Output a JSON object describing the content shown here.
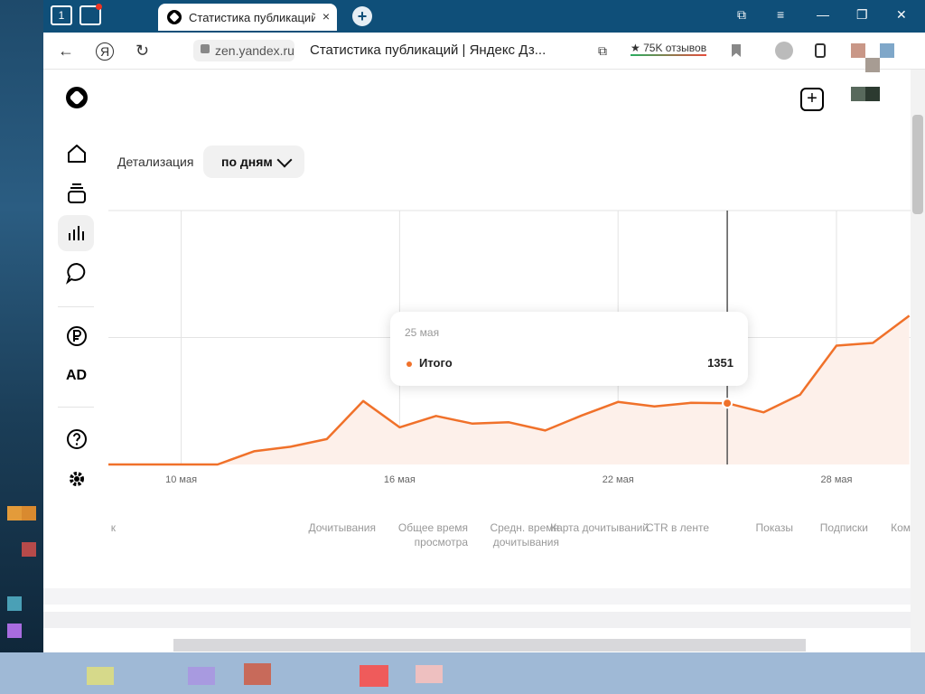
{
  "browser": {
    "tab_number": "1",
    "tab_title": "Статистика публикаций",
    "tab_close": "×",
    "newtab": "+",
    "host": "zen.yandex.ru",
    "page_title": "Статистика публикаций | Яндекс Дз...",
    "reviews": "★ 75K отзывов",
    "win_buttons": [
      "⧉",
      "≡",
      "—",
      "❐",
      "✕"
    ]
  },
  "app": {
    "ad_label": "AD",
    "detail_label": "Детализация",
    "detail_value": "по дням"
  },
  "chart_data": {
    "type": "area",
    "x": [
      "8 мая",
      "9 мая",
      "10 мая",
      "11 мая",
      "12 мая",
      "13 мая",
      "14 мая",
      "15 мая",
      "16 мая",
      "17 мая",
      "18 мая",
      "19 мая",
      "20 мая",
      "21 мая",
      "22 мая",
      "23 мая",
      "24 мая",
      "25 мая",
      "26 мая",
      "27 мая",
      "28 мая",
      "29 мая",
      "30 мая"
    ],
    "series": [
      {
        "name": "Итого",
        "values": [
          0,
          0,
          0,
          0,
          290,
          390,
          560,
          1400,
          820,
          1070,
          900,
          930,
          750,
          1080,
          1380,
          1280,
          1360,
          1351,
          1150,
          1540,
          2620,
          2680,
          3280
        ]
      }
    ],
    "x_tick_labels": [
      "10 мая",
      "16 мая",
      "22 мая",
      "28 мая"
    ],
    "ylim": [
      0,
      5600
    ],
    "grid": true,
    "line_color": "#f0712a",
    "fill_color": "#fdf0ea",
    "tooltip": {
      "date": "25 мая",
      "series": "Итого",
      "value": "1351"
    }
  },
  "columns": [
    {
      "label": "к"
    },
    {
      "label": "Дочитывания"
    },
    {
      "label": "Общее время просмотра"
    },
    {
      "label": "Средн. время дочитывания"
    },
    {
      "label": "Карта дочитываний"
    },
    {
      "label": "CTR в ленте"
    },
    {
      "label": "Показы"
    },
    {
      "label": "Подписки"
    },
    {
      "label": "Ком"
    }
  ]
}
